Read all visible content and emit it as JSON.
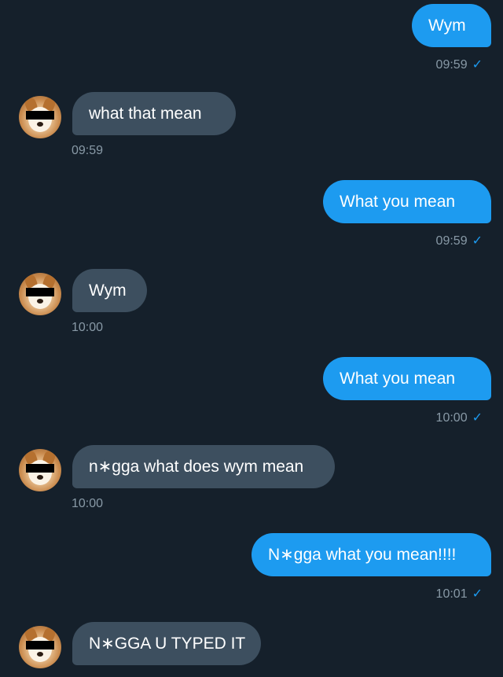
{
  "messages": [
    {
      "direction": "out",
      "text": "Wym",
      "time": "09:59",
      "check": "✓"
    },
    {
      "direction": "in",
      "text": "what that mean",
      "time": "09:59"
    },
    {
      "direction": "out",
      "text": "What you mean",
      "time": "09:59",
      "check": "✓"
    },
    {
      "direction": "in",
      "text": "Wym",
      "time": "10:00"
    },
    {
      "direction": "out",
      "text": "What you mean",
      "time": "10:00",
      "check": "✓"
    },
    {
      "direction": "in",
      "text": "n∗gga what does wym mean",
      "time": "10:00"
    },
    {
      "direction": "out",
      "text": "N∗gga what you mean!!!!",
      "time": "10:01",
      "check": "✓"
    },
    {
      "direction": "in",
      "text": "N∗GGA U TYPED IT"
    }
  ],
  "colors": {
    "background": "#15202b",
    "outgoing_bubble": "#1d9bf0",
    "incoming_bubble": "#3d4f5f",
    "timestamp": "#8899a6",
    "read_check": "#1d9bf0"
  },
  "icons": {
    "avatar": "shiba-avatar-icon",
    "read_receipt": "checkmark-icon"
  }
}
